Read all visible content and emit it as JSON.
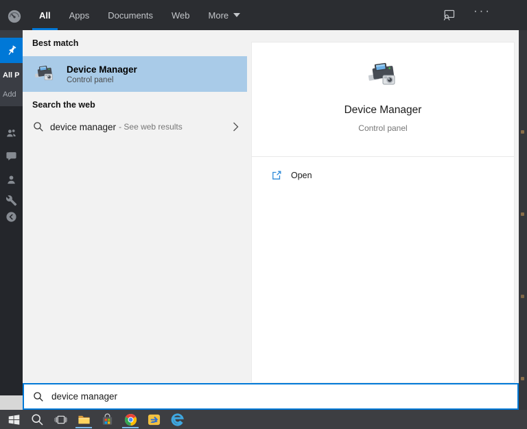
{
  "colors": {
    "accent": "#0078d7",
    "best_match_highlight": "#a9cbe8",
    "topbar_bg": "#2b2d31",
    "taskbar_bg": "#3d3e42",
    "panel_bg": "#f2f2f2"
  },
  "topbar": {
    "tabs": [
      {
        "label": "All",
        "active": true
      },
      {
        "label": "Apps",
        "active": false
      },
      {
        "label": "Documents",
        "active": false
      },
      {
        "label": "Web",
        "active": false
      },
      {
        "label": "More",
        "active": false,
        "dropdown": true
      }
    ],
    "ellipsis": "···"
  },
  "rail": {
    "partial_labels": [
      "All P",
      "Add"
    ],
    "icons": [
      "pin-icon",
      "people-icon",
      "chat-icon",
      "person-icon",
      "wrench-icon",
      "back-icon"
    ]
  },
  "results": {
    "best_match_header": "Best match",
    "best_match": {
      "title": "Device Manager",
      "subtitle": "Control panel"
    },
    "web_header": "Search the web",
    "web_result": {
      "query": "device manager",
      "annotation": "- See web results"
    }
  },
  "preview": {
    "title": "Device Manager",
    "subtitle": "Control panel",
    "open_label": "Open"
  },
  "search": {
    "value": "device manager"
  },
  "taskbar": {
    "icons": [
      {
        "name": "start-button",
        "running": false
      },
      {
        "name": "search-button",
        "running": false
      },
      {
        "name": "task-view-button",
        "running": false
      },
      {
        "name": "file-explorer-button",
        "running": true
      },
      {
        "name": "microsoft-store-button",
        "running": false
      },
      {
        "name": "chrome-button",
        "running": true
      },
      {
        "name": "remote-desktop-button",
        "running": false
      },
      {
        "name": "edge-button",
        "running": false
      }
    ]
  }
}
